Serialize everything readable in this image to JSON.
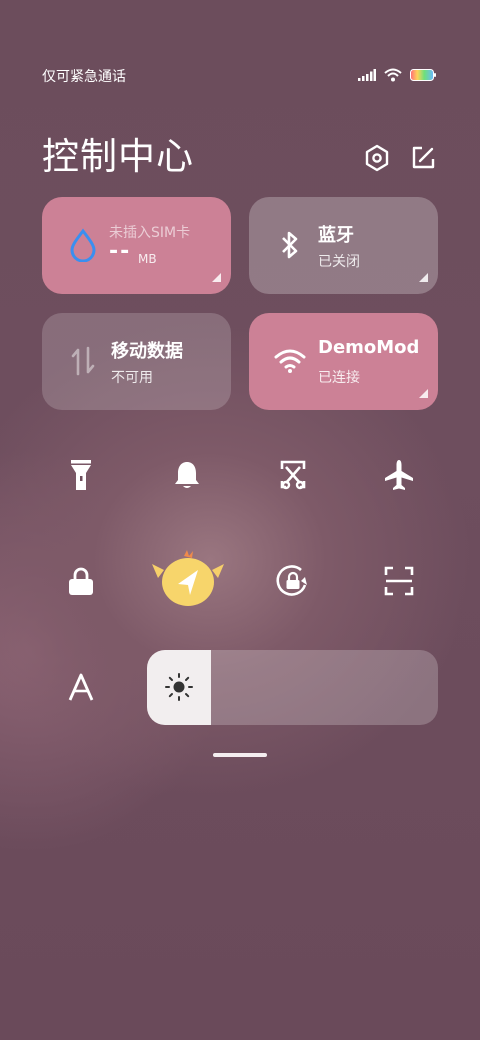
{
  "status": {
    "carrier_text": "仅可紧急通话"
  },
  "header": {
    "title": "控制中心"
  },
  "tiles": {
    "data_usage": {
      "line1": "未插入SIM卡",
      "value": "--",
      "unit": "MB"
    },
    "bluetooth": {
      "label": "蓝牙",
      "status": "已关闭"
    },
    "mobile_data": {
      "label": "移动数据",
      "status": "不可用"
    },
    "wifi": {
      "label": "DemoMod",
      "status": "已连接"
    }
  },
  "quick_toggles": [
    "flashlight-icon",
    "bell-icon",
    "screenshot-icon",
    "airplane-icon",
    "lock-icon",
    "location-icon",
    "rotation-lock-icon",
    "scan-icon",
    "font-icon"
  ],
  "brightness": {
    "level": 0.22
  },
  "colors": {
    "tile_active": "#cc8196",
    "water_icon": "#3a8ff0"
  }
}
